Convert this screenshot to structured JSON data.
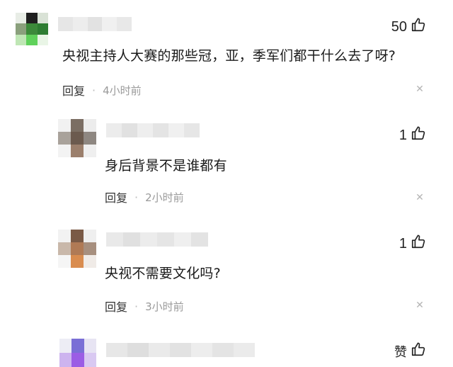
{
  "colors": {
    "text": "#1a1a1a",
    "meta": "#9a9a9a",
    "icon": "#222222",
    "close": "#b5b5b5"
  },
  "comments": [
    {
      "likes": "50",
      "content": "央视主持人大赛的那些冠，亚，季军们都干什么去了呀?",
      "reply_label": "回复",
      "time": "4小时前"
    },
    {
      "likes": "1",
      "content": "身后背景不是谁都有",
      "reply_label": "回复",
      "time": "2小时前"
    },
    {
      "likes": "1",
      "content": "央视不需要文化吗?",
      "reply_label": "回复",
      "time": "3小时前"
    },
    {
      "likes": "赞"
    }
  ]
}
